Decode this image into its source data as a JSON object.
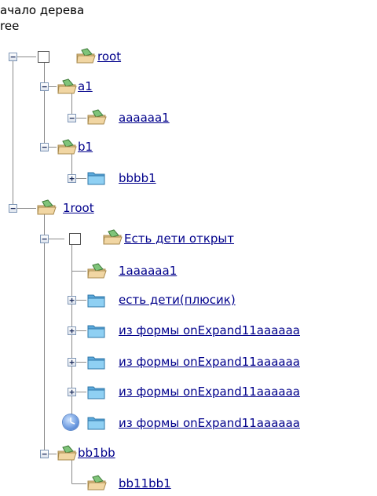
{
  "header": {
    "line1": "ачало дерева",
    "line2": "ree"
  },
  "tree": [
    {
      "label": "root",
      "icon": "open-folder-icon",
      "toggle": "−",
      "checkbox": true
    },
    {
      "label": "a1",
      "icon": "open-folder-icon",
      "toggle": "−"
    },
    {
      "label": "aaaaaa1",
      "icon": "open-folder-icon",
      "toggle": "−"
    },
    {
      "label": "b1",
      "icon": "open-folder-icon",
      "toggle": "−"
    },
    {
      "label": "bbbb1",
      "icon": "closed-folder-icon",
      "toggle": "+"
    },
    {
      "label": "1root",
      "icon": "open-folder-icon",
      "toggle": "−"
    },
    {
      "label": "Есть дети открыт",
      "icon": "open-folder-icon",
      "toggle": "−",
      "checkbox": true
    },
    {
      "label": "1aaaaaa1",
      "icon": "open-folder-icon",
      "toggle": ""
    },
    {
      "label": "есть дети(плюсик)",
      "icon": "closed-folder-icon",
      "toggle": "+"
    },
    {
      "label": "из формы onExpand11aaaaaa",
      "icon": "closed-folder-icon",
      "toggle": "+"
    },
    {
      "label": "из формы onExpand11aaaaaa",
      "icon": "closed-folder-icon",
      "toggle": "+"
    },
    {
      "label": "из формы onExpand11aaaaaa",
      "icon": "closed-folder-icon",
      "toggle": "+"
    },
    {
      "label": "из формы onExpand11aaaaaa",
      "icon": "closed-folder-icon",
      "toggle": "loading"
    },
    {
      "label": "bb1bb",
      "icon": "open-folder-icon",
      "toggle": "−"
    },
    {
      "label": "bb11bb1",
      "icon": "open-folder-icon",
      "toggle": ""
    }
  ],
  "colors": {
    "link": "#00008b",
    "folder_blue": "#6fb8e6",
    "folder_tan": "#e2c089",
    "tree_line": "#8a8a8a"
  }
}
